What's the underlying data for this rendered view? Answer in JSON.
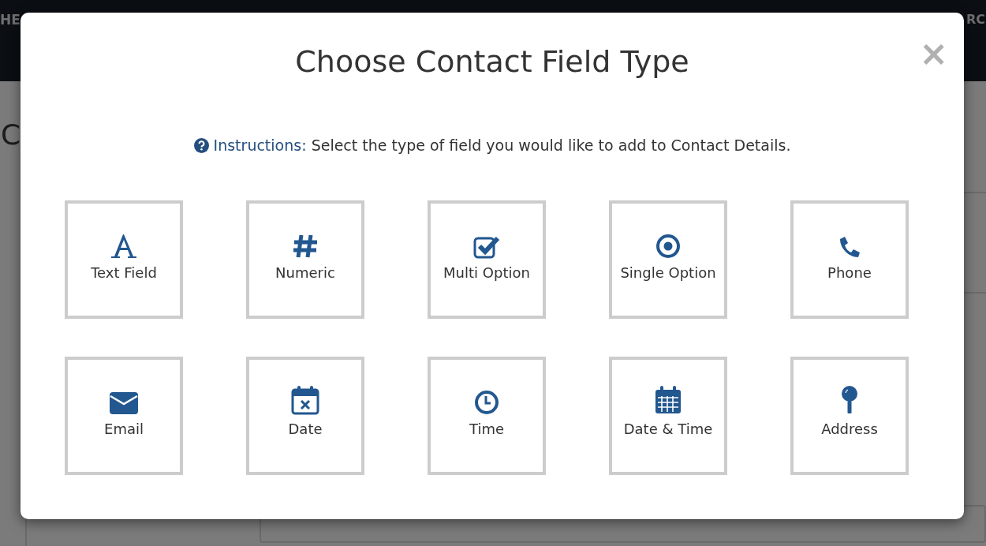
{
  "background": {
    "header_left": "HE",
    "header_right": "RC",
    "page_heading": "C"
  },
  "dialog": {
    "title": "Choose Contact Field Type",
    "close": "×",
    "instructions": {
      "label": "Instructions:",
      "text": "Select the type of field you would like to add to Contact Details."
    },
    "field_types": [
      {
        "kind": "text",
        "label": "Text Field"
      },
      {
        "kind": "numeric",
        "label": "Numeric"
      },
      {
        "kind": "multi",
        "label": "Multi Option"
      },
      {
        "kind": "single",
        "label": "Single Option"
      },
      {
        "kind": "phone",
        "label": "Phone"
      },
      {
        "kind": "email",
        "label": "Email"
      },
      {
        "kind": "date",
        "label": "Date"
      },
      {
        "kind": "time",
        "label": "Time"
      },
      {
        "kind": "datetime",
        "label": "Date & Time"
      },
      {
        "kind": "address",
        "label": "Address"
      }
    ]
  }
}
